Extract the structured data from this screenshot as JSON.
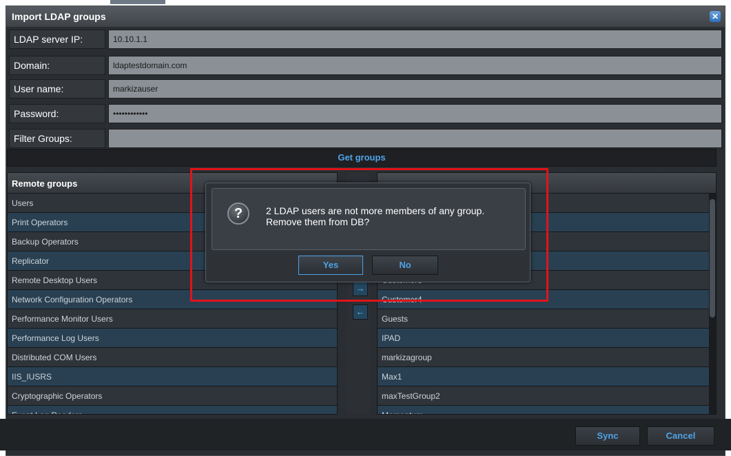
{
  "window": {
    "title": "Import LDAP groups"
  },
  "form": {
    "server_ip_label": "LDAP server IP:",
    "server_ip_value": "10.10.1.1",
    "domain_label": "Domain:",
    "domain_value": "ldaptestdomain.com",
    "username_label": "User name:",
    "username_value": "markizauser",
    "password_label": "Password:",
    "password_value": "••••••••••••",
    "filter_label": "Filter Groups:",
    "filter_value": ""
  },
  "get_groups_label": "Get groups",
  "remote_panel": {
    "header": "Remote groups",
    "items": [
      "Users",
      "Print Operators",
      "Backup Operators",
      "Replicator",
      "Remote Desktop Users",
      "Network Configuration Operators",
      "Performance Monitor Users",
      "Performance Log Users",
      "Distributed COM Users",
      "IIS_IUSRS",
      "Cryptographic Operators",
      "Event Log Readers"
    ]
  },
  "local_panel": {
    "items": [
      "",
      "",
      "",
      "",
      "Customer3",
      "Customer4",
      "Guests",
      "IPAD",
      "markizagroup",
      "Max1",
      "maxTestGroup2",
      "Momentum"
    ]
  },
  "icons": {
    "close": "close-icon",
    "arrow_right": "arrow-right-icon",
    "arrow_left": "arrow-left-icon",
    "question": "question-icon"
  },
  "arrows": {
    "right": "→",
    "left": "←"
  },
  "dialog": {
    "line1": "2 LDAP users are not more members of any group.",
    "line2": "Remove them from DB?",
    "yes_label": "Yes",
    "no_label": "No"
  },
  "footer": {
    "sync_label": "Sync",
    "cancel_label": "Cancel"
  },
  "colors": {
    "accent": "#4fa3e6",
    "highlight": "#e0141b"
  }
}
